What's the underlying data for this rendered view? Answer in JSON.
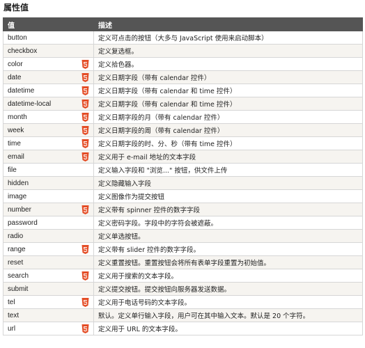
{
  "title": "属性值",
  "table": {
    "headers": [
      "值",
      "描述"
    ],
    "rows": [
      {
        "value": "button",
        "html5": false,
        "desc": "定义可点击的按钮（大多与 JavaScript 使用来启动脚本）"
      },
      {
        "value": "checkbox",
        "html5": false,
        "desc": "定义复选框。"
      },
      {
        "value": "color",
        "html5": true,
        "desc": "定义拾色器。"
      },
      {
        "value": "date",
        "html5": true,
        "desc": "定义日期字段（带有 calendar 控件）"
      },
      {
        "value": "datetime",
        "html5": true,
        "desc": "定义日期字段（带有 calendar 和 time 控件）"
      },
      {
        "value": "datetime-local",
        "html5": true,
        "desc": "定义日期字段（带有 calendar 和 time 控件）"
      },
      {
        "value": "month",
        "html5": true,
        "desc": "定义日期字段的月（带有 calendar 控件）"
      },
      {
        "value": "week",
        "html5": true,
        "desc": "定义日期字段的周（带有 calendar 控件）"
      },
      {
        "value": "time",
        "html5": true,
        "desc": "定义日期字段的时、分、秒（带有 time 控件）"
      },
      {
        "value": "email",
        "html5": true,
        "desc": "定义用于 e-mail 地址的文本字段"
      },
      {
        "value": "file",
        "html5": false,
        "desc": "定义输入字段和 \"浏览...\" 按钮，供文件上传"
      },
      {
        "value": "hidden",
        "html5": false,
        "desc": "定义隐藏输入字段"
      },
      {
        "value": "image",
        "html5": false,
        "desc": "定义图像作为提交按钮"
      },
      {
        "value": "number",
        "html5": true,
        "desc": "定义带有 spinner 控件的数字字段"
      },
      {
        "value": "password",
        "html5": false,
        "desc": "定义密码字段。字段中的字符会被遮蔽。"
      },
      {
        "value": "radio",
        "html5": false,
        "desc": "定义单选按钮。"
      },
      {
        "value": "range",
        "html5": true,
        "desc": "定义带有 slider 控件的数字字段。"
      },
      {
        "value": "reset",
        "html5": false,
        "desc": "定义重置按钮。重置按钮会将所有表单字段重置为初始值。"
      },
      {
        "value": "search",
        "html5": true,
        "desc": "定义用于搜索的文本字段。"
      },
      {
        "value": "submit",
        "html5": false,
        "desc": "定义提交按钮。提交按钮向服务器发送数据。"
      },
      {
        "value": "tel",
        "html5": true,
        "desc": "定义用于电话号码的文本字段。"
      },
      {
        "value": "text",
        "html5": false,
        "desc": "默认。定义单行输入字段，用户可在其中输入文本。默认是 20 个字符。"
      },
      {
        "value": "url",
        "html5": true,
        "desc": "定义用于 URL 的文本字段。"
      }
    ]
  },
  "icon": {
    "name": "html5-icon",
    "color": "#e44d26"
  }
}
